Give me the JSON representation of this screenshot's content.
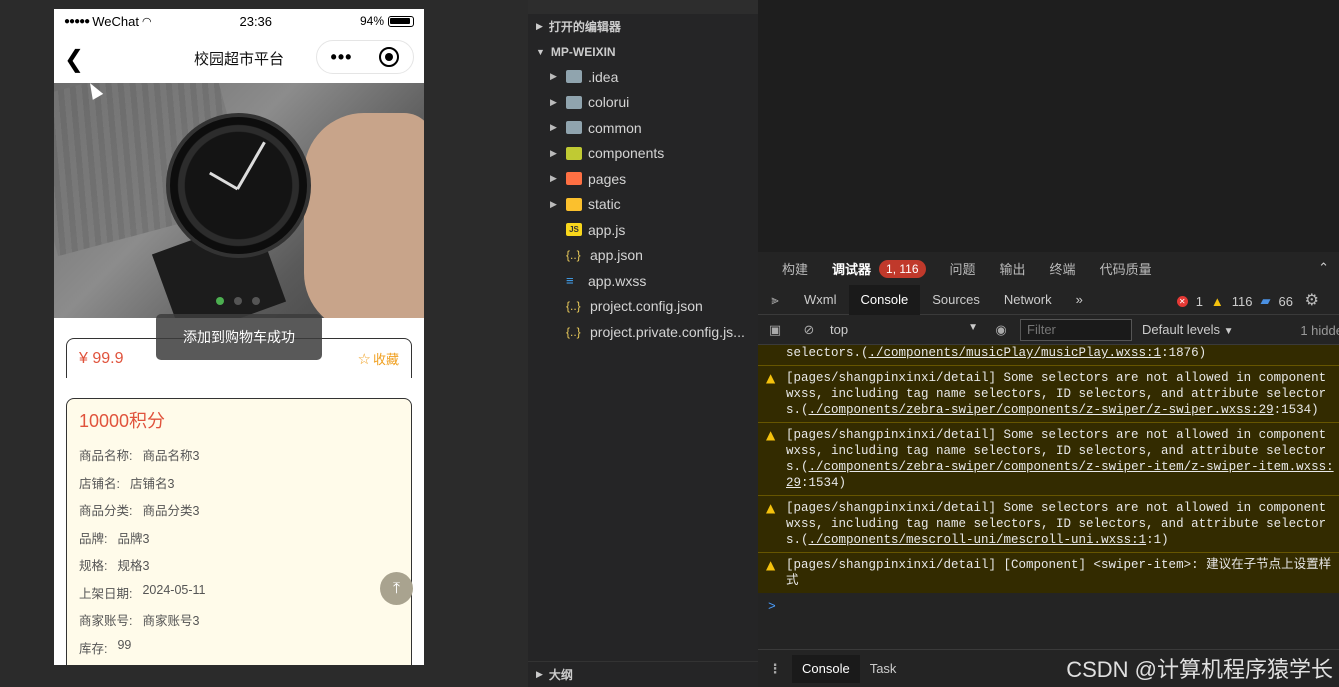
{
  "phone": {
    "status": {
      "carrier": "WeChat",
      "time": "23:36",
      "battery": "94%"
    },
    "nav": {
      "title": "校园超市平台"
    },
    "toast": "添加到购物车成功",
    "price": "¥ 99.9",
    "favorite_label": "收藏",
    "points": "10000积分",
    "details": [
      {
        "label": "商品名称:",
        "value": "商品名称3"
      },
      {
        "label": "店铺名:",
        "value": "店铺名3"
      },
      {
        "label": "商品分类:",
        "value": "商品分类3"
      },
      {
        "label": "品牌:",
        "value": "品牌3"
      },
      {
        "label": "规格:",
        "value": "规格3"
      },
      {
        "label": "上架日期:",
        "value": "2024-05-11"
      },
      {
        "label": "商家账号:",
        "value": "商家账号3"
      },
      {
        "label": "库存:",
        "value": "99"
      }
    ]
  },
  "explorer": {
    "open_editors": "打开的编辑器",
    "project": "MP-WEIXIN",
    "items": [
      {
        "name": ".idea",
        "type": "folder"
      },
      {
        "name": "colorui",
        "type": "folder"
      },
      {
        "name": "common",
        "type": "folder"
      },
      {
        "name": "components",
        "type": "folder-components"
      },
      {
        "name": "pages",
        "type": "folder-pages"
      },
      {
        "name": "static",
        "type": "folder-static"
      },
      {
        "name": "app.js",
        "type": "js"
      },
      {
        "name": "app.json",
        "type": "json"
      },
      {
        "name": "app.wxss",
        "type": "css"
      },
      {
        "name": "project.config.json",
        "type": "json"
      },
      {
        "name": "project.private.config.js...",
        "type": "json"
      }
    ],
    "outline": "大纲"
  },
  "debugger": {
    "top_tabs": [
      "构建",
      "调试器",
      "问题",
      "输出",
      "终端",
      "代码质量"
    ],
    "badge": "1, 116",
    "tabs": [
      "Wxml",
      "Console",
      "Sources",
      "Network"
    ],
    "more_tabs": "»",
    "error_count": "1",
    "warning_count": "116",
    "info_count": "66",
    "context": "top",
    "filter_placeholder": "Filter",
    "levels": "Default levels",
    "hidden": "1 hidde",
    "logs": {
      "first": {
        "pre": "selectors.(",
        "link": "./components/musicPlay/musicPlay.wxss:1",
        "post": ":1876)"
      },
      "entries": [
        {
          "text": "[pages/shangpinxinxi/detail] Some selectors are not allowed in component wxss, including tag name selectors, ID selectors, and attribute selectors.(",
          "link": "./components/zebra-swiper/components/z-swiper/z-swiper.wxss:29",
          "post": ":1534)"
        },
        {
          "text": "[pages/shangpinxinxi/detail] Some selectors are not allowed in component wxss, including tag name selectors, ID selectors, and attribute selectors.(",
          "link": "./components/zebra-swiper/components/z-swiper-item/z-swiper-item.wxss:29",
          "post": ":1534)"
        },
        {
          "text": "[pages/shangpinxinxi/detail] Some selectors are not allowed in component wxss, including tag name selectors, ID selectors, and attribute selectors.(",
          "link": "./components/mescroll-uni/mescroll-uni.wxss:1",
          "post": ":1)"
        },
        {
          "text": "[pages/shangpinxinxi/detail] [Component] <swiper-item>: 建议在子节点上设置样式",
          "link": "",
          "post": ""
        }
      ]
    },
    "prompt": ">",
    "drawer_tabs": [
      "Console",
      "Task"
    ],
    "watermark": "CSDN @计算机程序猿学长"
  }
}
